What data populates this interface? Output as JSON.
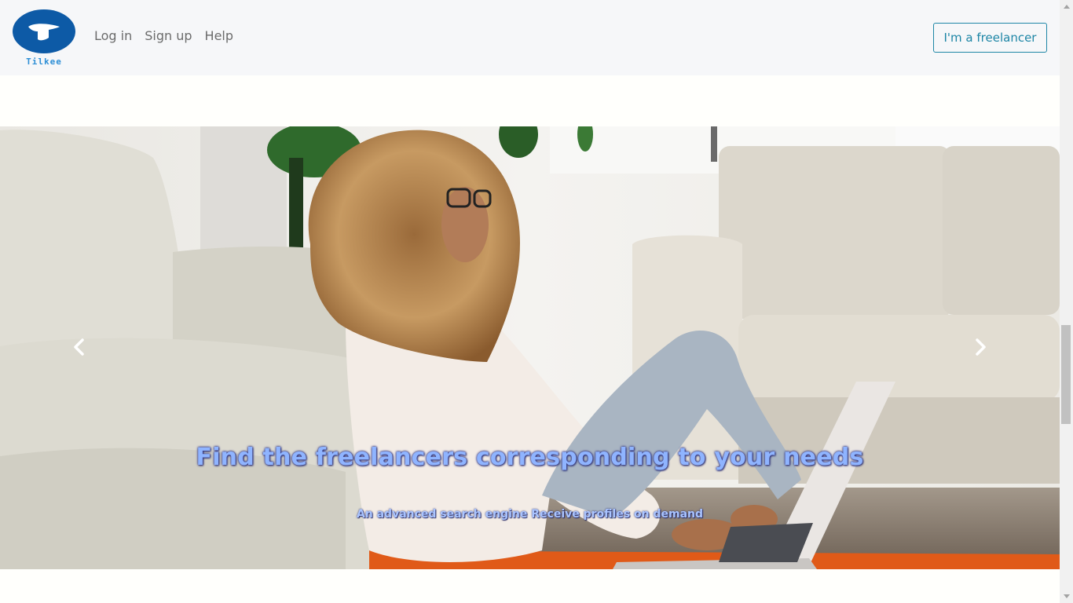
{
  "brand": {
    "logo_text": "Tilkee",
    "logo_color": "#0d5aa6"
  },
  "nav": {
    "links": [
      {
        "label": "Log in"
      },
      {
        "label": "Sign up"
      },
      {
        "label": "Help"
      }
    ],
    "freelancer_button": "I'm a freelancer",
    "accent_color": "#1e86a6"
  },
  "hero": {
    "title": "Find the freelancers corresponding to your needs",
    "subtitle": "An advanced search engine Receive profiles on demand",
    "prev_icon": "chevron-left-icon",
    "next_icon": "chevron-right-icon"
  },
  "scrollbar": {
    "position_fraction": 0.54
  }
}
